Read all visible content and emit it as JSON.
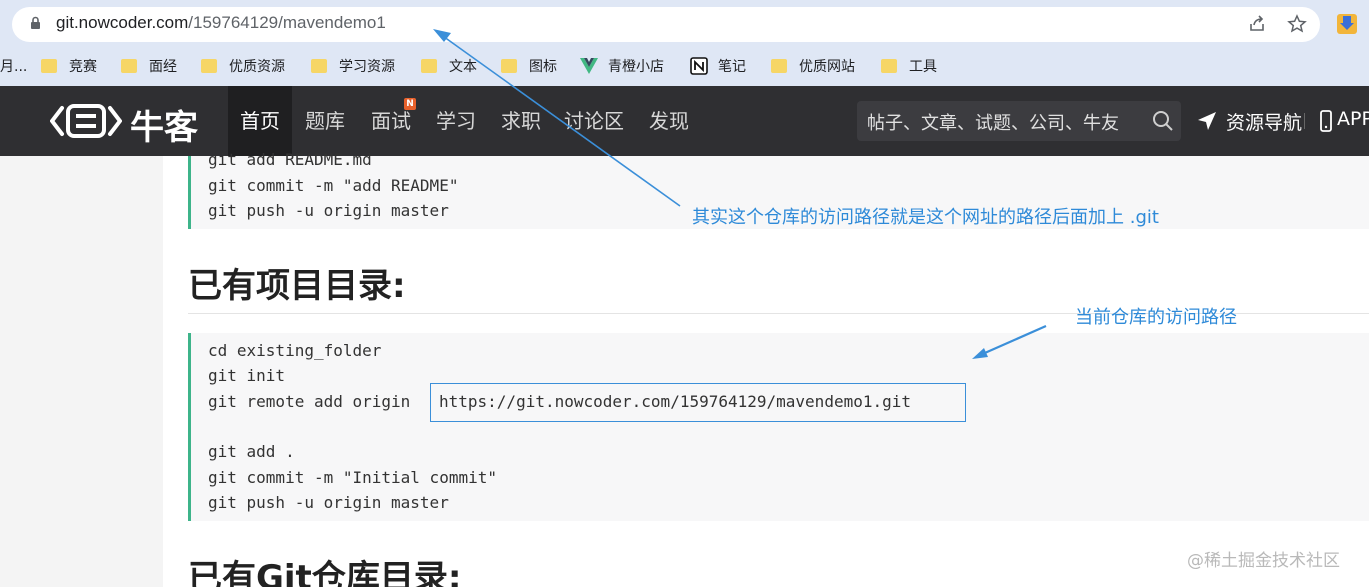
{
  "browser": {
    "url_host": "git.nowcoder.com",
    "url_path": "/159764129/mavendemo1"
  },
  "bookmarks": {
    "truncated": "月...",
    "items": [
      {
        "label": "竞赛",
        "icon": "folder-icon"
      },
      {
        "label": "面经",
        "icon": "folder-icon"
      },
      {
        "label": "优质资源",
        "icon": "folder-icon"
      },
      {
        "label": "学习资源",
        "icon": "folder-icon"
      },
      {
        "label": "文本",
        "icon": "folder-icon"
      },
      {
        "label": "图标",
        "icon": "folder-icon"
      },
      {
        "label": "青橙小店",
        "icon": "vue-icon"
      },
      {
        "label": "笔记",
        "icon": "notion-icon"
      },
      {
        "label": "优质网站",
        "icon": "folder-icon"
      },
      {
        "label": "工具",
        "icon": "folder-icon"
      }
    ]
  },
  "site": {
    "logo_text": "牛客",
    "nav": [
      "首页",
      "题库",
      "面试",
      "学习",
      "求职",
      "讨论区",
      "发现"
    ],
    "new_badge": "N",
    "search_placeholder": "帖子、文章、试题、公司、牛友",
    "resource_nav": "资源导航",
    "app_link": "APP",
    "accent_color": "#3eb48a"
  },
  "content": {
    "code_top": [
      "git add README.md",
      "git commit -m \"add README\"",
      "git push -u origin master"
    ],
    "heading_existing_dir": "已有项目目录:",
    "code_existing": {
      "line1": "cd existing_folder",
      "line2": "git init",
      "line3_prefix": "git remote add origin",
      "line3_url": "https://git.nowcoder.com/159764129/mavendemo1.git",
      "line4": "git add .",
      "line5": "git commit -m \"Initial commit\"",
      "line6": "git push -u origin master"
    },
    "heading_existing_git": "已有Git仓库目录:"
  },
  "annotations": {
    "note_top": "其实这个仓库的访问路径就是这个网址的路径后面加上 .git",
    "note_current": "当前仓库的访问路径",
    "color": "#2e8ad8"
  },
  "watermark": "@稀土掘金技术社区"
}
